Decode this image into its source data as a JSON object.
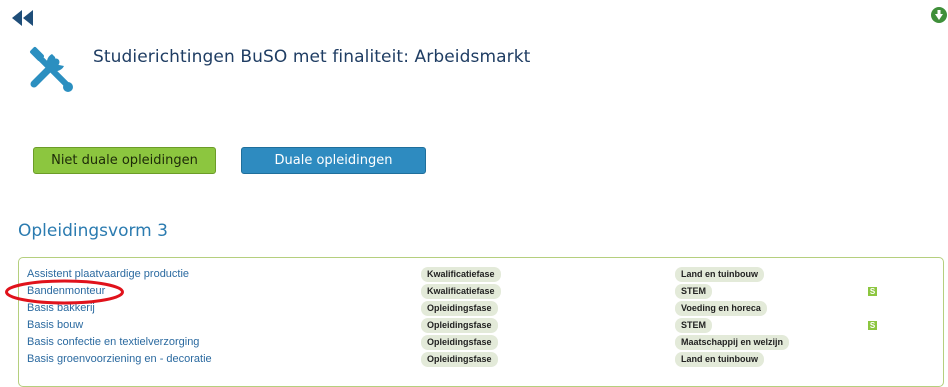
{
  "header": {
    "title": "Studierichtingen BuSO met finaliteit: Arbeidsmarkt"
  },
  "icons": {
    "back": "double-chevron-left-icon",
    "download": "cloud-download-icon",
    "header": "tools-icon"
  },
  "buttons": {
    "niet_duaal": "Niet duale opleidingen",
    "duaal": "Duale opleidingen"
  },
  "section": {
    "title": "Opleidingsvorm 3"
  },
  "rows": [
    {
      "name": "Assistent plaatvaardige productie",
      "fase": "Kwalificatiefase",
      "domein": "Land en tuinbouw",
      "badge": ""
    },
    {
      "name": "Bandenmonteur",
      "fase": "Kwalificatiefase",
      "domein": "STEM",
      "badge": "S"
    },
    {
      "name": "Basis bakkerij",
      "fase": "Opleidingsfase",
      "domein": "Voeding en horeca",
      "badge": ""
    },
    {
      "name": "Basis bouw",
      "fase": "Opleidingsfase",
      "domein": "STEM",
      "badge": "S"
    },
    {
      "name": "Basis confectie en textielverzorging",
      "fase": "Opleidingsfase",
      "domein": "Maatschappij en welzijn",
      "badge": ""
    },
    {
      "name": "Basis groenvoorziening en - decoratie",
      "fase": "Opleidingsfase",
      "domein": "Land en tuinbouw",
      "badge": ""
    }
  ],
  "colors": {
    "green": "#8cc63f",
    "blue": "#2e8bc0",
    "title": "#1f3d63",
    "section": "#2b7bb0",
    "annotation": "#e0121b"
  }
}
